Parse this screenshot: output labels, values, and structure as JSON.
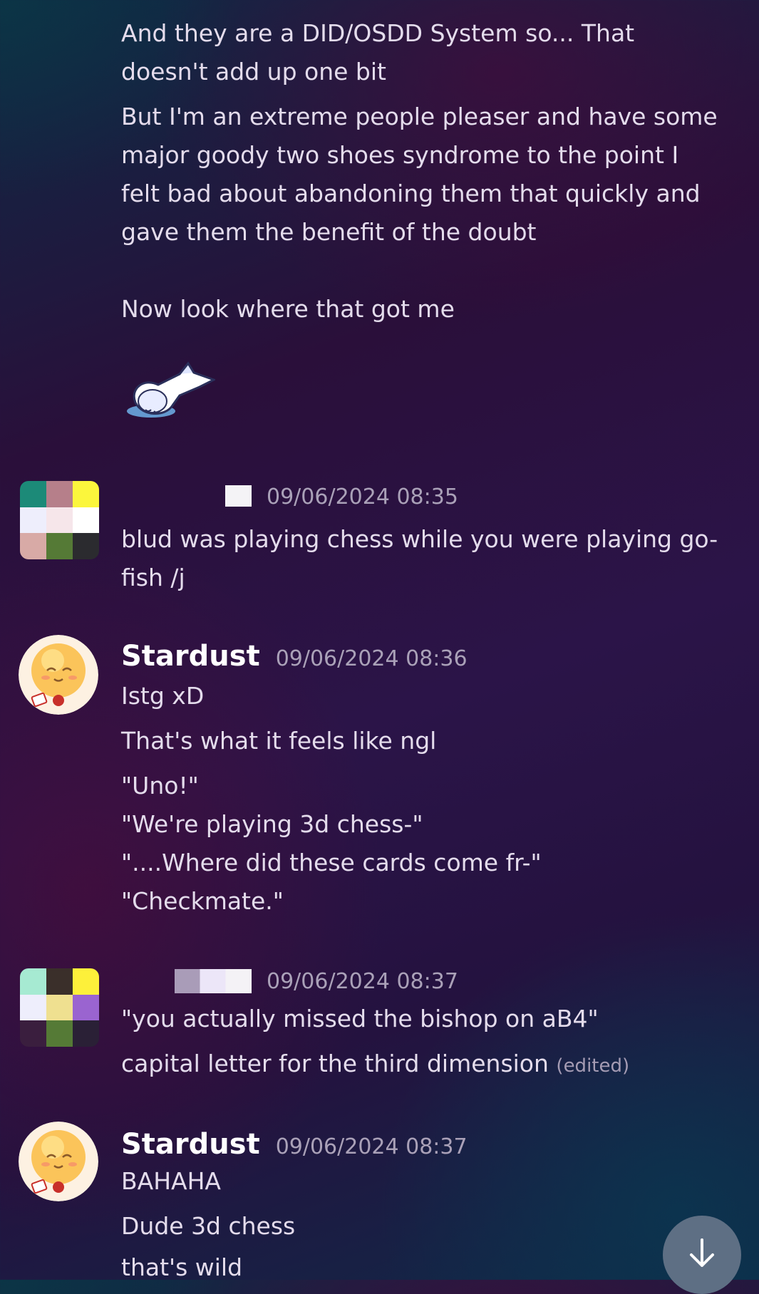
{
  "messages": [
    {
      "author": "",
      "lines": [
        "And they are a DID/OSDD System so... That doesn't add up one bit",
        "But I'm an extreme people pleaser and have some major goody two shoes syndrome to the point I felt bad about abandoning them that quickly and gave them the benefit of the doubt\n\nNow look where that got me"
      ],
      "sticker": "sleeping-ghost-sticker"
    },
    {
      "author": "",
      "timestamp": "09/06/2024 08:35",
      "lines": [
        "blud was playing chess while you were playing go-fish /j"
      ]
    },
    {
      "author": "Stardust",
      "timestamp": "09/06/2024 08:36",
      "lines": [
        "Istg xD",
        "That's what it feels like ngl",
        "\"Uno!\"\n\"We're playing 3d chess-\"\n\"....Where did these cards come fr-\"\n\"Checkmate.\""
      ]
    },
    {
      "author": "",
      "timestamp": "09/06/2024 08:37",
      "lines": [
        "\"you actually missed the bishop on aB4\"",
        "capital letter for the third dimension"
      ],
      "edited_label": "(edited)"
    },
    {
      "author": "Stardust",
      "timestamp": "09/06/2024 08:37",
      "lines": [
        "BAHAHA",
        "Dude 3d chess",
        "that's wild"
      ]
    }
  ],
  "scroll_button": {
    "icon": "arrow-down-icon"
  }
}
